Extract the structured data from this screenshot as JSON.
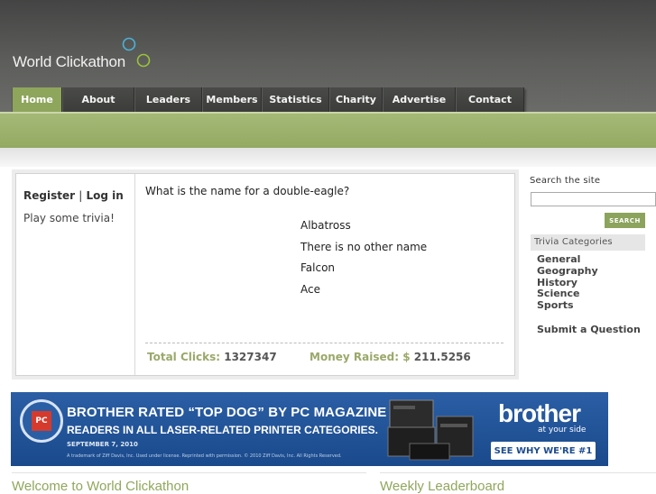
{
  "site": {
    "name": "World Clickathon"
  },
  "nav": {
    "items": [
      {
        "label": "Home",
        "active": true
      },
      {
        "label": "About"
      },
      {
        "label": "Leaders"
      },
      {
        "label": "Members"
      },
      {
        "label": "Statistics"
      },
      {
        "label": "Charity"
      },
      {
        "label": "Advertise"
      },
      {
        "label": "Contact"
      }
    ]
  },
  "trivia": {
    "register": "Register",
    "separator": "|",
    "login": "Log in",
    "play": "Play some trivia!",
    "question": "What is the name for a double-eagle?",
    "answers": [
      "Albatross",
      "There is no other name",
      "Falcon",
      "Ace"
    ],
    "clicks_label": "Total Clicks:",
    "clicks_value": "1327347",
    "money_label": "Money Raised: $",
    "money_value": "211.5256"
  },
  "sidebar": {
    "search_label": "Search the site",
    "search_button": "SEARCH",
    "categories_title": "Trivia Categories",
    "categories": [
      "General",
      "Geography",
      "History",
      "Science",
      "Sports"
    ],
    "submit": "Submit a Question"
  },
  "ad": {
    "badge": "PC",
    "line1": "BROTHER RATED “TOP DOG” BY PC MAGAZINE",
    "line2": "READERS IN ALL LASER-RELATED PRINTER CATEGORIES.",
    "date": "SEPTEMBER 7, 2010",
    "fine_print": "A trademark of Ziff Davis, Inc. Used under license. Reprinted with permission. © 2010 Ziff Davis, Inc. All Rights Reserved.",
    "brand": "brother",
    "brand_tagline": "at your side",
    "cta": "SEE WHY WE'RE #1"
  },
  "sections": {
    "welcome": "Welcome to World Clickathon",
    "leaderboard": "Weekly Leaderboard"
  },
  "colors": {
    "accent": "#8ea55c",
    "header": "#5d5e5b",
    "ad_blue": "#1f4f90"
  }
}
